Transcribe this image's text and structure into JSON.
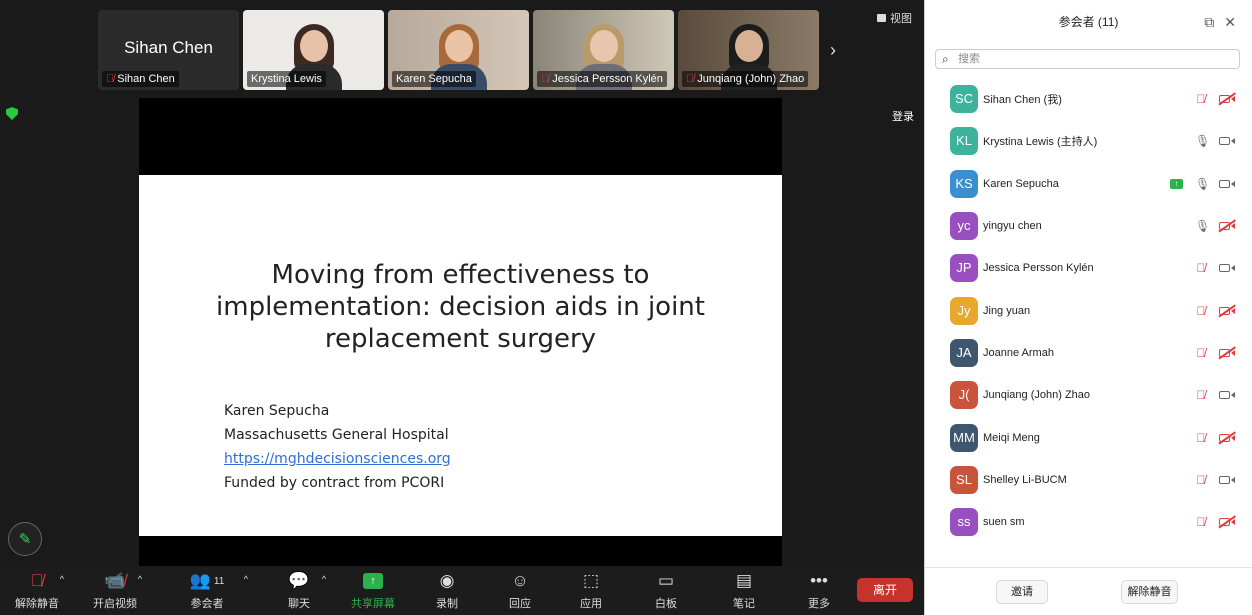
{
  "thumbnails": [
    {
      "name": "Sihan Chen",
      "display_text": "Sihan Chen",
      "muted": true,
      "video": false,
      "active": false
    },
    {
      "name": "Krystina Lewis",
      "muted": false,
      "video": true,
      "active": true
    },
    {
      "name": "Karen Sepucha",
      "muted": false,
      "video": true,
      "active": false
    },
    {
      "name": "Jessica Persson Kylén",
      "muted": true,
      "video": true,
      "active": false
    },
    {
      "name": "Junqiang (John) Zhao",
      "muted": true,
      "video": true,
      "active": false
    }
  ],
  "top_bar": {
    "view_label": "视图",
    "login_label": "登录"
  },
  "slide": {
    "title": "Moving from effectiveness to\nimplementation: decision aids in joint\nreplacement surgery",
    "author": "Karen Sepucha",
    "affiliation": "Massachusetts General Hospital",
    "url": "https://mghdecisionsciences.org",
    "funding": "Funded by contract from PCORI"
  },
  "toolbar": {
    "unmute": "解除静音",
    "start_video": "开启视频",
    "participants": "参会者",
    "participants_count": "11",
    "chat": "聊天",
    "share_screen": "共享屏幕",
    "record": "录制",
    "reactions": "回应",
    "apps": "应用",
    "whiteboard": "白板",
    "notes": "笔记",
    "more": "更多",
    "leave": "离开"
  },
  "panel": {
    "title": "参会者 (11)",
    "search_placeholder": "搜索",
    "participants": [
      {
        "initials": "SC",
        "name": "Sihan Chen (我)",
        "color": "#3eb39c",
        "mic": "off",
        "cam": "off",
        "sharing": false
      },
      {
        "initials": "KL",
        "name": "Krystina Lewis (主持人)",
        "color": "#3eb39c",
        "mic": "on",
        "cam": "on",
        "sharing": false
      },
      {
        "initials": "KS",
        "name": "Karen Sepucha",
        "color": "#3a8fd1",
        "mic": "on",
        "cam": "on",
        "sharing": true
      },
      {
        "initials": "yc",
        "name": "yingyu chen",
        "color": "#9a4fc0",
        "mic": "on",
        "cam": "off",
        "sharing": false
      },
      {
        "initials": "JP",
        "name": "Jessica Persson Kylén",
        "color": "#9a4fc0",
        "mic": "off",
        "cam": "on",
        "sharing": false
      },
      {
        "initials": "Jy",
        "name": "Jing yuan",
        "color": "#e8a72d",
        "mic": "off",
        "cam": "off",
        "sharing": false
      },
      {
        "initials": "JA",
        "name": "Joanne Armah",
        "color": "#3f566f",
        "mic": "off",
        "cam": "off",
        "sharing": false
      },
      {
        "initials": "J(",
        "name": "Junqiang (John) Zhao",
        "color": "#c8553b",
        "mic": "off",
        "cam": "on",
        "sharing": false
      },
      {
        "initials": "MM",
        "name": "Meiqi Meng",
        "color": "#3f566f",
        "mic": "off",
        "cam": "off",
        "sharing": false
      },
      {
        "initials": "SL",
        "name": "Shelley Li-BUCM",
        "color": "#c8553b",
        "mic": "off",
        "cam": "on",
        "sharing": false
      },
      {
        "initials": "ss",
        "name": "suen sm",
        "color": "#9a4fc0",
        "mic": "off",
        "cam": "off",
        "sharing": false
      }
    ],
    "invite": "邀请",
    "unmute_me": "解除静音"
  }
}
